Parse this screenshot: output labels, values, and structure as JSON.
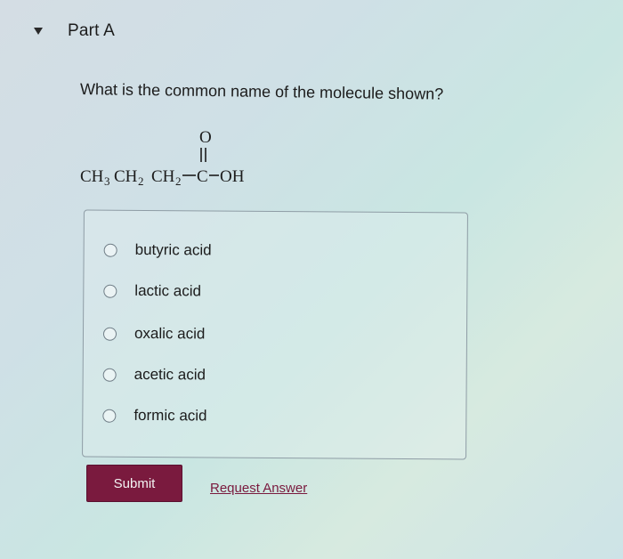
{
  "part": {
    "title": "Part A"
  },
  "question": {
    "text": "What is the common name of the molecule shown?"
  },
  "molecule": {
    "carbonyl_o": "O",
    "ch3": "CH",
    "ch3_sub": "3",
    "ch2a": "CH",
    "ch2a_sub": "2",
    "ch2b": "CH",
    "ch2b_sub": "2",
    "c": "C",
    "oh": "OH"
  },
  "options": [
    {
      "label": "butyric acid"
    },
    {
      "label": "lactic acid"
    },
    {
      "label": "oxalic acid"
    },
    {
      "label": "acetic acid"
    },
    {
      "label": "formic acid"
    }
  ],
  "actions": {
    "submit_label": "Submit",
    "request_label": "Request Answer"
  },
  "colors": {
    "submit_bg": "#7a1a3e",
    "link": "#7a1a3e"
  }
}
